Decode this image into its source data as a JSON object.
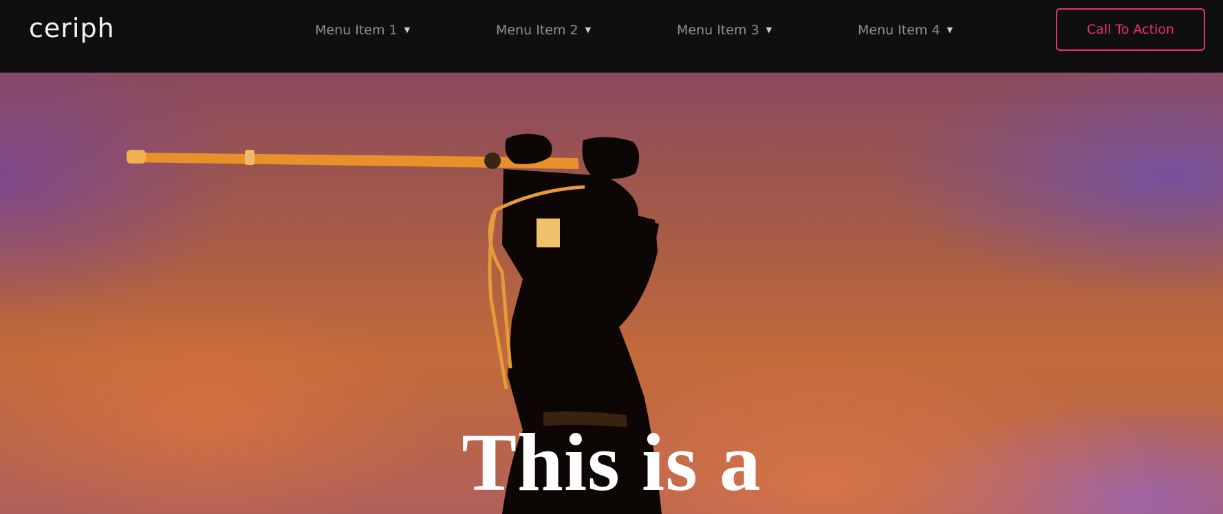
{
  "header": {
    "logo_text": "ceriph",
    "nav": [
      {
        "label": "Menu Item 1"
      },
      {
        "label": "Menu Item 2"
      },
      {
        "label": "Menu Item 3"
      },
      {
        "label": "Menu Item 4"
      }
    ],
    "cta_label": "Call To Action"
  },
  "hero": {
    "heading": "This is a",
    "image_subject": "kendo-silhouette-sunset"
  },
  "colors": {
    "header_bg": "#0f0f0f",
    "accent": "#f0306e",
    "logo_dot_teal": "#2ec4b6",
    "nav_text": "#8f8f8f"
  },
  "icons": {
    "nav_caret": "caret-down-icon"
  }
}
